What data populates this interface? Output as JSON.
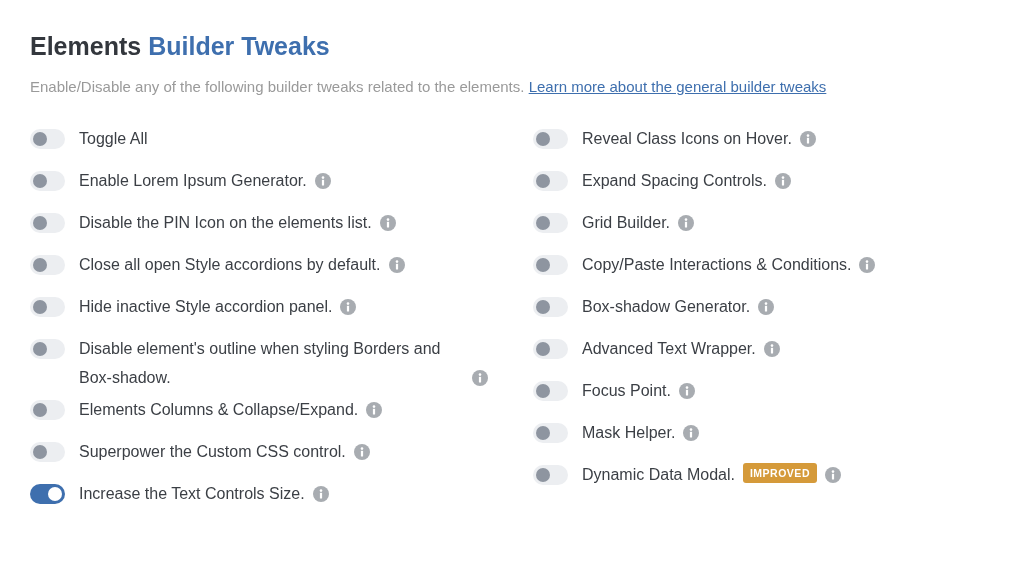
{
  "header": {
    "title": "Elements",
    "title_highlight": "Builder Tweaks",
    "description": "Enable/Disable any of the following builder tweaks related to the elements.",
    "link": "Learn more about the general builder tweaks"
  },
  "columns": [
    [
      {
        "label": "Toggle All",
        "on": false,
        "info": false
      },
      {
        "label": "Enable Lorem Ipsum Generator.",
        "on": false,
        "info": true
      },
      {
        "label": "Disable the PIN Icon on the elements list.",
        "on": false,
        "info": true
      },
      {
        "label": "Close all open Style accordions by default.",
        "on": false,
        "info": true
      },
      {
        "label": "Hide inactive Style accordion panel.",
        "on": false,
        "info": true
      },
      {
        "label": "Disable element's outline when styling Borders and Box-shadow.",
        "on": false,
        "info": true
      },
      {
        "label": "Elements Columns & Collapse/Expand.",
        "on": false,
        "info": true
      },
      {
        "label": "Superpower the Custom CSS control.",
        "on": false,
        "info": true
      },
      {
        "label": "Increase the Text Controls Size.",
        "on": true,
        "info": true
      }
    ],
    [
      {
        "label": "Reveal Class Icons on Hover.",
        "on": false,
        "info": true
      },
      {
        "label": "Expand Spacing Controls.",
        "on": false,
        "info": true
      },
      {
        "label": "Grid Builder.",
        "on": false,
        "info": true
      },
      {
        "label": "Copy/Paste Interactions & Conditions.",
        "on": false,
        "info": true
      },
      {
        "label": "Box-shadow Generator.",
        "on": false,
        "info": true
      },
      {
        "label": "Advanced Text Wrapper.",
        "on": false,
        "info": true
      },
      {
        "label": "Focus Point.",
        "on": false,
        "info": true
      },
      {
        "label": "Mask Helper.",
        "on": false,
        "info": true
      },
      {
        "label": "Dynamic Data Modal.",
        "on": false,
        "info": true,
        "badge": "IMPROVED"
      }
    ]
  ]
}
